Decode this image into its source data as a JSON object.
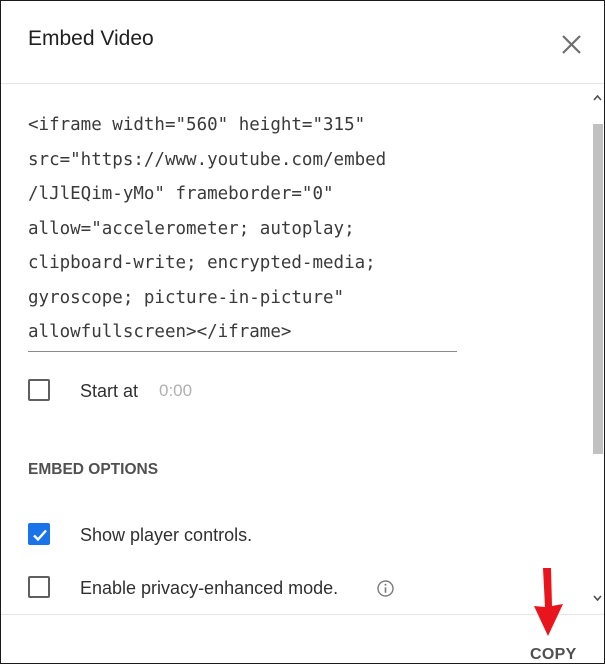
{
  "dialog": {
    "title": "Embed Video",
    "close_icon": "close-icon"
  },
  "embed_code": {
    "lines": [
      "<iframe width=\"560\" height=\"315\"",
      "src=\"https://www.youtube.com/embed",
      "/lJlEQim-yMo\" frameborder=\"0\"",
      "allow=\"accelerometer; autoplay;",
      "clipboard-write; encrypted-media;",
      "gyroscope; picture-in-picture\"",
      "allowfullscreen></iframe>"
    ]
  },
  "start_at": {
    "label": "Start at",
    "time": "0:00",
    "checked": false
  },
  "embed_options": {
    "heading": "EMBED OPTIONS",
    "show_player_controls": {
      "label": "Show player controls.",
      "checked": true
    },
    "privacy_enhanced": {
      "label": "Enable privacy-enhanced mode.",
      "checked": false
    }
  },
  "footer": {
    "copy_label": "COPY"
  },
  "colors": {
    "checkbox_checked": "#1a73e8",
    "annotation_arrow": "#e8161c"
  }
}
